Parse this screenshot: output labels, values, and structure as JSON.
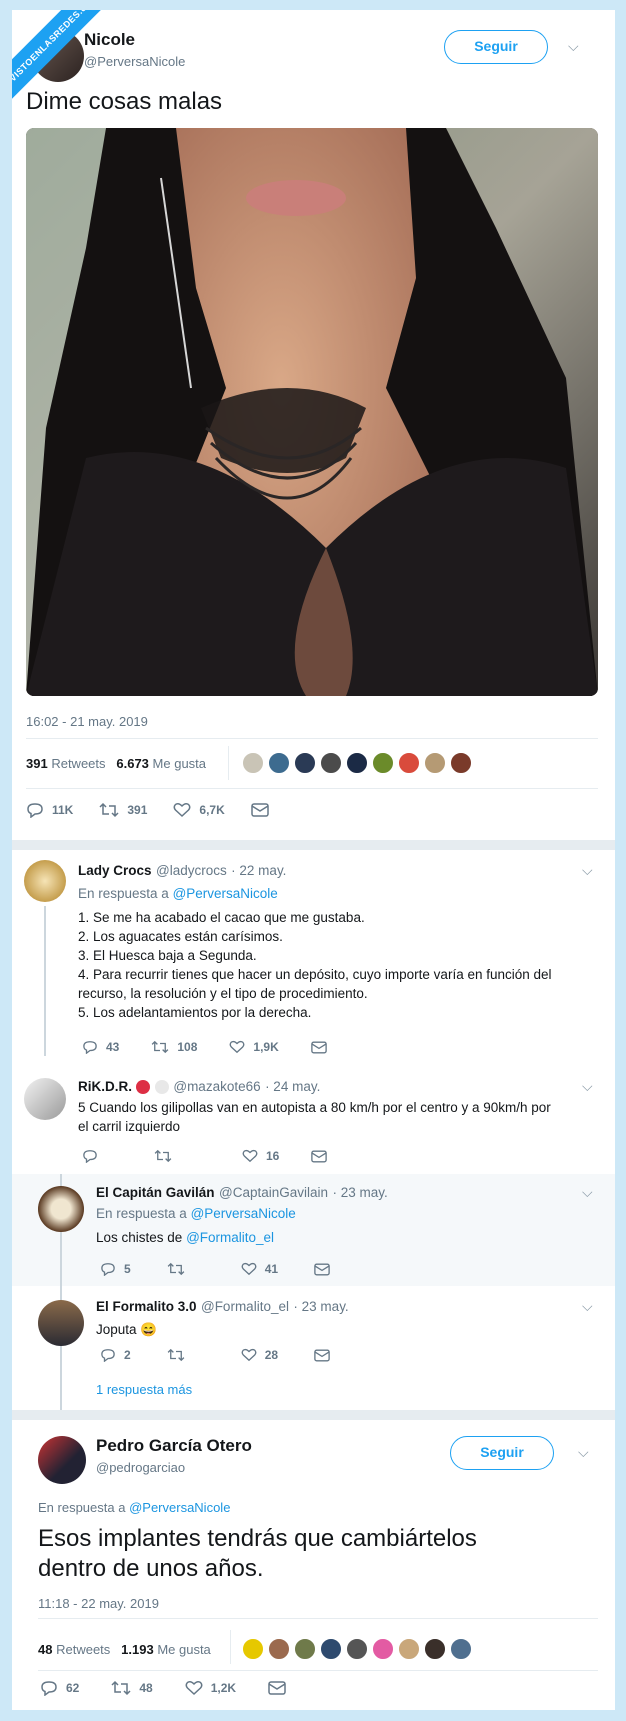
{
  "watermark": "VISTOENLASREDES.com",
  "tweet": {
    "name": "Nicole",
    "handle": "@PerversaNicole",
    "follow_label": "Seguir",
    "text": "Dime cosas malas",
    "timestamp": "16:02 - 21 may. 2019",
    "retweets_count": "391",
    "retweets_label": "Retweets",
    "likes_count": "6.673",
    "likes_label": "Me gusta",
    "replies": "11K",
    "rts": "391",
    "favs": "6,7K"
  },
  "replies": [
    {
      "name": "Lady Crocs",
      "handle": "@ladycrocs",
      "date": "· 22 may.",
      "reply_prefix": "En respuesta a",
      "reply_to": "@PerversaNicole",
      "lines": [
        "1. Se me ha acabado el cacao que me gustaba.",
        "2. Los aguacates están carísimos.",
        "3. El Huesca baja a Segunda.",
        "4. Para recurrir tienes que hacer un depósito, cuyo importe varía en función del",
        "recurso, la resolución y el tipo de procedimiento.",
        "5. Los adelantamientos por la derecha."
      ],
      "replies": "43",
      "rts": "108",
      "favs": "1,9K"
    },
    {
      "name": "RiK.D.R.",
      "handle": "@mazakote66",
      "date": "· 24 may.",
      "lines": [
        "5 Cuando los gilipollas van en autopista a 80 km/h por el centro y a 90km/h por",
        "el carril izquierdo"
      ],
      "replies": "",
      "rts": "",
      "favs": "16"
    },
    {
      "name": "El Capitán Gavilán",
      "handle": "@CaptainGavilain",
      "date": "· 23 may.",
      "reply_prefix": "En respuesta a",
      "reply_to": "@PerversaNicole",
      "text_prefix": "Los chistes de",
      "text_link": "@Formalito_el",
      "replies": "5",
      "rts": "",
      "favs": "41"
    },
    {
      "name": "El Formalito 3.0",
      "handle": "@Formalito_el",
      "date": "· 23 may.",
      "text": "Joputa",
      "emoji": "😄",
      "replies": "2",
      "rts": "",
      "favs": "28"
    }
  ],
  "more_replies": "1 respuesta más",
  "tweet2": {
    "name": "Pedro García Otero",
    "handle": "@pedrogarciao",
    "follow_label": "Seguir",
    "reply_prefix": "En respuesta a",
    "reply_to": "@PerversaNicole",
    "text_line1": "Esos implantes tendrás que cambiártelos",
    "text_line2": "dentro de unos años.",
    "timestamp": "11:18 - 22 may. 2019",
    "retweets_count": "48",
    "retweets_label": "Retweets",
    "likes_count": "1.193",
    "likes_label": "Me gusta",
    "replies": "62",
    "rts": "48",
    "favs": "1,2K"
  },
  "colors": {
    "accent": "#1da1f2",
    "link": "#1b95e0",
    "muted": "#657786",
    "background": "#cde8f7"
  }
}
